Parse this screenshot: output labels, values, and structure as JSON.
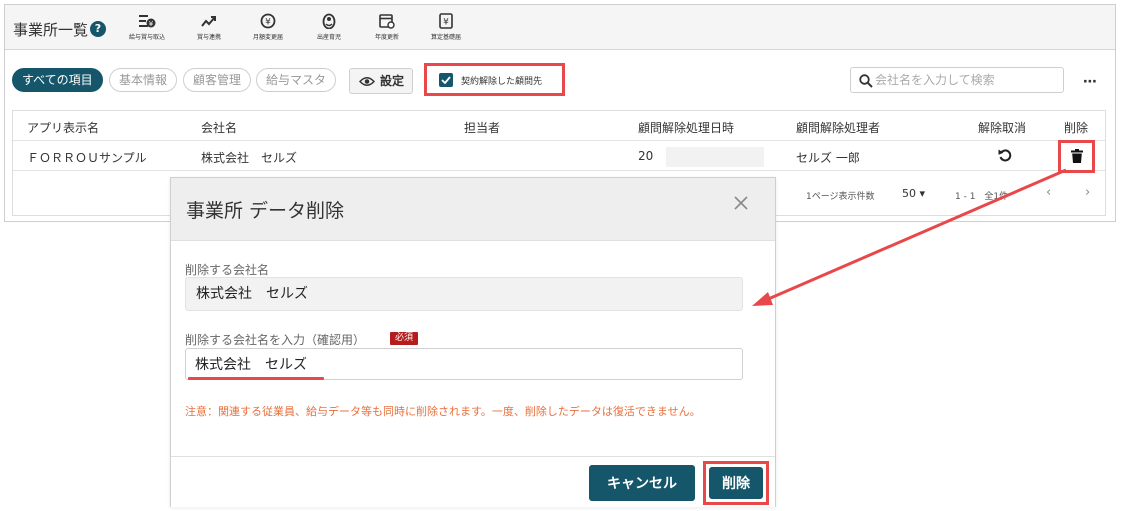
{
  "app": {
    "title": "事業所一覧",
    "help_icon": "?",
    "toolbar": [
      {
        "label": "給与賞与取込",
        "icon": "import-icon"
      },
      {
        "label": "賞与連携",
        "icon": "trend-icon"
      },
      {
        "label": "月額変更届",
        "icon": "yen-change-icon"
      },
      {
        "label": "出産育児",
        "icon": "baby-icon"
      },
      {
        "label": "年度更新",
        "icon": "calendar-refresh-icon"
      },
      {
        "label": "算定基礎届",
        "icon": "yen-document-icon"
      }
    ]
  },
  "filters": {
    "chips": [
      "すべての項目",
      "基本情報",
      "顧客管理",
      "給与マスタ"
    ],
    "settings_label": "設定",
    "terminated_label": "契約解除した顧問先",
    "terminated_checked": true,
    "search_placeholder": "会社名を入力して検索",
    "more_icon": "⋯"
  },
  "table": {
    "headers": [
      "アプリ表示名",
      "会社名",
      "担当者",
      "顧問解除処理日時",
      "顧問解除処理者",
      "解除取消",
      "削除"
    ],
    "rows": [
      {
        "app_name": "ＦＯＲＲＯＵサンプル",
        "company": "株式会社　セルズ",
        "manager": "",
        "date": "20",
        "handler": "セルズ 一郎"
      }
    ],
    "pager": {
      "per_page_label": "1ページ表示件数",
      "per_page_value": "50",
      "range": "1 - 1　全1件"
    }
  },
  "dialog": {
    "title": "事業所 データ削除",
    "company_label": "削除する会社名",
    "company_value": "株式会社　セルズ",
    "confirm_label": "削除する会社名を入力（確認用）",
    "required_badge": "必須",
    "confirm_value": "株式会社　セルズ",
    "warning": "注意：関連する従業員、給与データ等も同時に削除されます。一度、削除したデータは復活できません。",
    "cancel_label": "キャンセル",
    "delete_label": "削除"
  },
  "colors": {
    "primary": "#16566a",
    "highlight": "#e8484a",
    "warning_text": "#e8703d",
    "required": "#b51c1c"
  }
}
